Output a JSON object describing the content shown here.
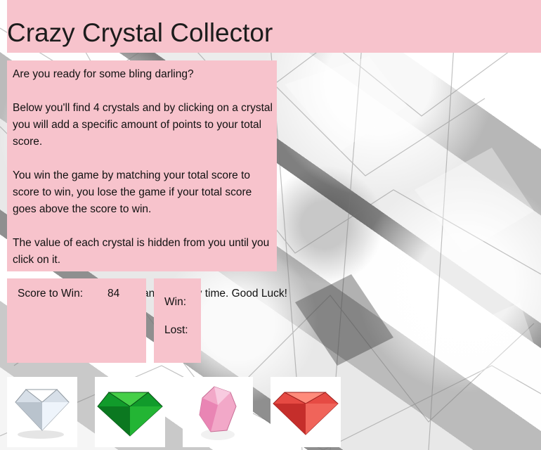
{
  "header": {
    "title": "Crazy Crystal Collector"
  },
  "instructions": {
    "text": "Are you ready for some bling darling?\n\nBelow you'll find 4 crystals and by clicking on a crystal you will add a specific amount of points to your total score.\n\nYou win the game by matching your total score to score to win, you lose the game if your total score goes above the score to win.\n\nThe value of each crystal is hidden from you until you click on it.",
    "trailing_text": "The value of each crystal changes every time. Good Luck!"
  },
  "scoreboard": {
    "score_to_win_label": "Score to Win:",
    "score_to_win_value": "84",
    "win_label": "Win:",
    "lost_label": "Lost:"
  },
  "crystals": [
    {
      "icon": "clear-diamond-icon",
      "color": "#d7dfe8"
    },
    {
      "icon": "green-diamond-icon",
      "color": "#119b2b"
    },
    {
      "icon": "pink-diamond-icon",
      "color": "#f2a8c8"
    },
    {
      "icon": "red-diamond-icon",
      "color": "#e64a43"
    }
  ],
  "colors": {
    "panel": "#f7c3cc",
    "text": "#111111"
  }
}
